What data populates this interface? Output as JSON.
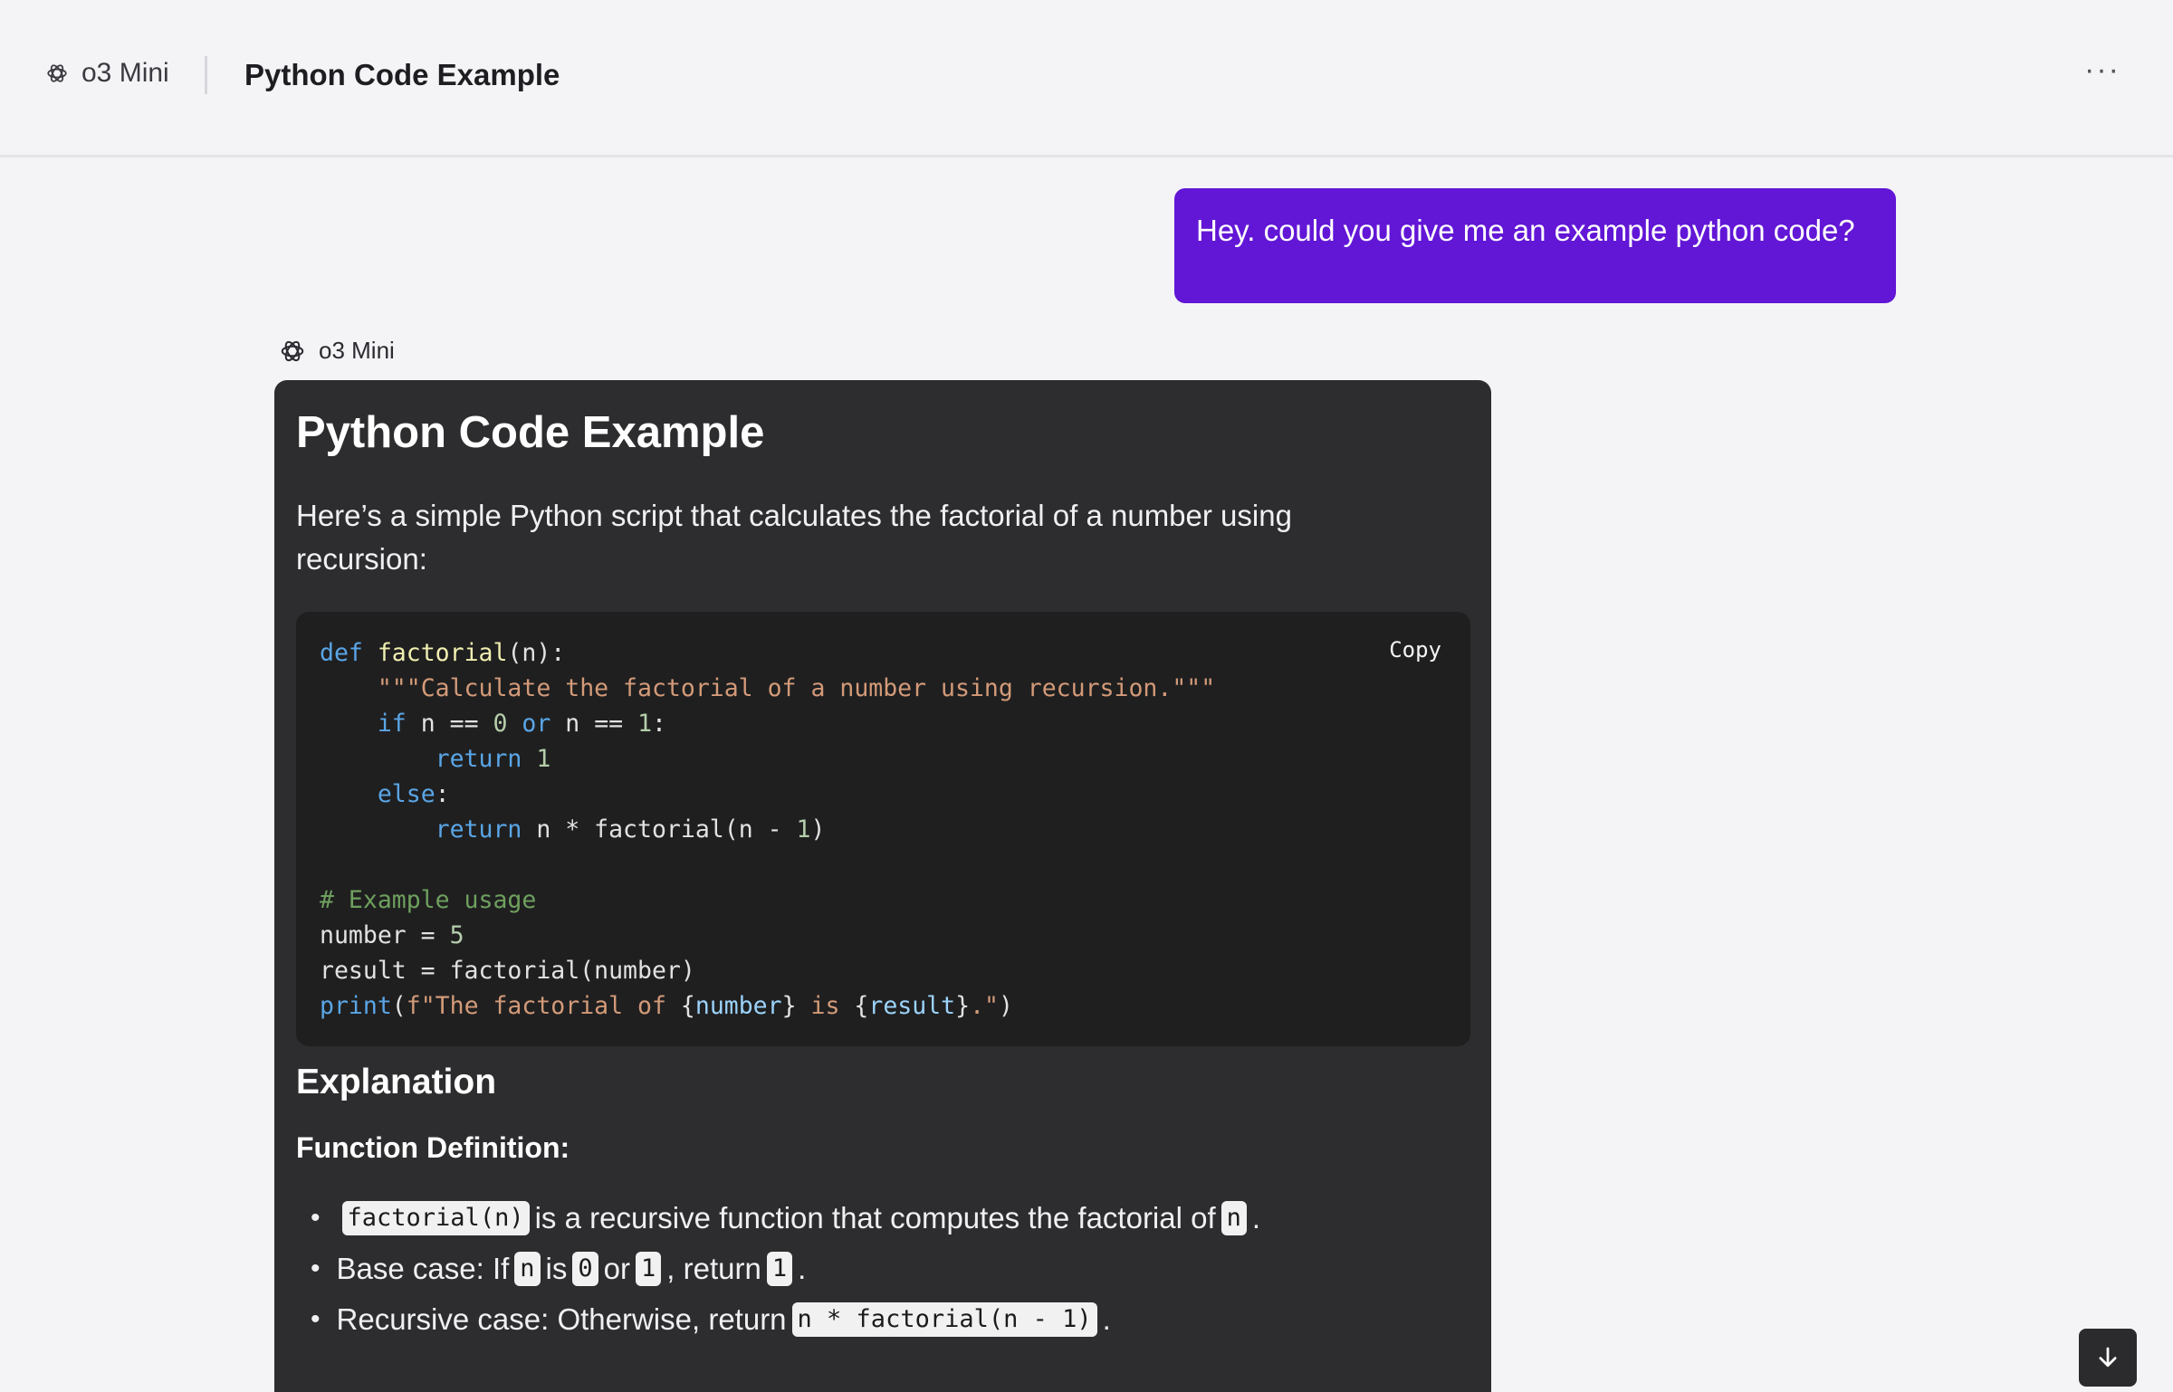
{
  "header": {
    "model_name": "o3 Mini",
    "title": "Python Code Example",
    "more_label": "···"
  },
  "user_message": "Hey. could you give me an example python code?",
  "assistant": {
    "model_name": "o3 Mini",
    "heading": "Python Code Example",
    "intro": "Here’s a simple Python script that calculates the factorial of a number using recursion:",
    "copy_label": "Copy",
    "code": {
      "def_kw": "def",
      "func_name": "factorial",
      "signature_rest": "(n):",
      "docstring": "\"\"\"Calculate the factorial of a number using recursion.\"\"\"",
      "if_kw": "if",
      "cond_a": " n == ",
      "zero": "0",
      "or_kw": " or",
      "cond_b": " n == ",
      "one": "1",
      "colon": ":",
      "return_kw": "return",
      "return_one": "1",
      "else_kw": "else",
      "return_kw2": "return",
      "recursive_expr": " n * factorial(n - ",
      "recursive_one": "1",
      "close_paren": ")",
      "comment": "# Example usage",
      "number_assign": "number = ",
      "five": "5",
      "result_assign": "result = factorial(number)",
      "print_kw": "print",
      "open_paren": "(",
      "fstr_a": "f\"The factorial of ",
      "brace_open_1": "{",
      "var_number": "number",
      "brace_close_1": "}",
      "is_text": " is ",
      "brace_open_2": "{",
      "var_result": "result",
      "brace_close_2": "}",
      "fstr_end": ".\"",
      "final_paren": ")"
    },
    "explanation_heading": "Explanation",
    "function_def_heading": "Function Definition:",
    "bullets": {
      "b1_code": "factorial(n)",
      "b1_text": "is a recursive function that computes the factorial of",
      "b1_var": "n",
      "b1_end": ".",
      "b2_text_a": "Base case: If",
      "b2_var": "n",
      "b2_text_b": "is",
      "b2_zero": "0",
      "b2_text_c": "or",
      "b2_one": "1",
      "b2_text_d": ", return",
      "b2_ret": "1",
      "b2_end": ".",
      "b3_text": "Recursive case: Otherwise, return",
      "b3_code": "n * factorial(n - 1)",
      "b3_end": "."
    }
  },
  "scroll_button_icon": "arrow-down-icon"
}
